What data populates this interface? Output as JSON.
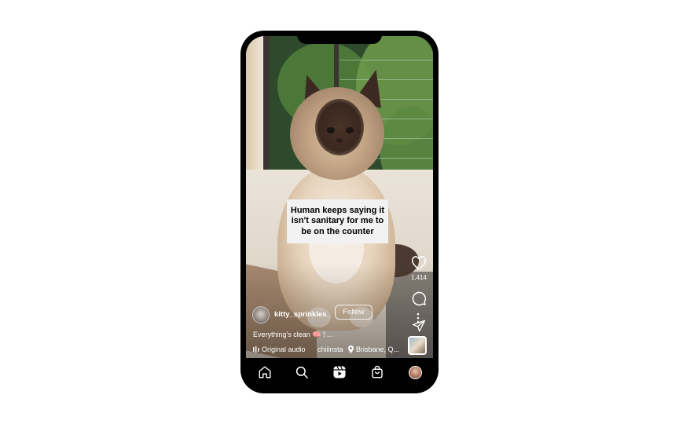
{
  "overlay_text": "Human keeps saying it isn't sanitary for me to be on the counter",
  "actions": {
    "like_icon": "heart-icon",
    "like_count": "1,414",
    "comment_icon": "comment-icon",
    "share_icon": "paper-plane-icon",
    "more_icon": "more-dots-icon"
  },
  "post": {
    "username": "kitty_sprinkles_",
    "follow_label": "Follow",
    "caption": "Everything's clean 🧠 ! ...",
    "audio_icon": "audio-bars-icon",
    "audio_label": "Original audio",
    "audio_user": "chiiinsta",
    "location_icon": "location-pin-icon",
    "location_label": "Brisbane, Q..."
  },
  "bottom_nav": {
    "items": [
      {
        "name": "home",
        "icon": "home-icon"
      },
      {
        "name": "search",
        "icon": "search-icon"
      },
      {
        "name": "reels",
        "icon": "reels-icon",
        "active": true
      },
      {
        "name": "shop",
        "icon": "shopping-bag-icon"
      },
      {
        "name": "profile",
        "icon": "profile-avatar"
      }
    ]
  },
  "colors": {
    "frame": "#000000",
    "text": "#ffffff",
    "overlay_bg": "#f2f2f2"
  }
}
